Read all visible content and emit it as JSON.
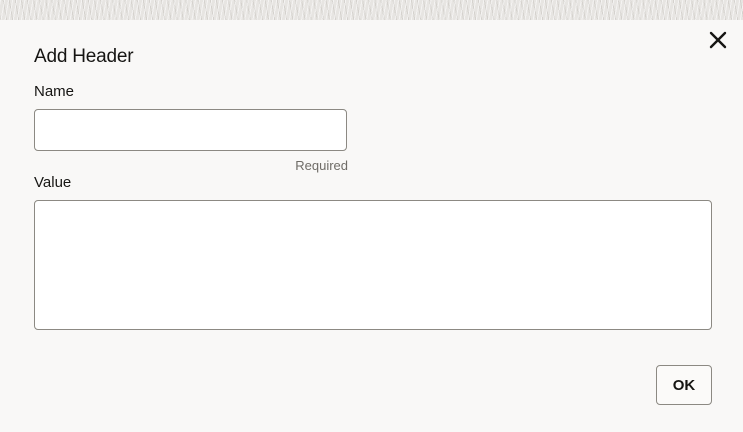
{
  "dialog": {
    "title": "Add Header",
    "close_icon": "close-icon"
  },
  "form": {
    "name_label": "Name",
    "name_value": "",
    "name_hint": "Required",
    "value_label": "Value",
    "value_value": ""
  },
  "actions": {
    "ok_label": "OK"
  },
  "colors": {
    "background": "#f9f8f7",
    "field_border": "#8c8983",
    "text": "#161513",
    "hint": "#6f6c67"
  }
}
